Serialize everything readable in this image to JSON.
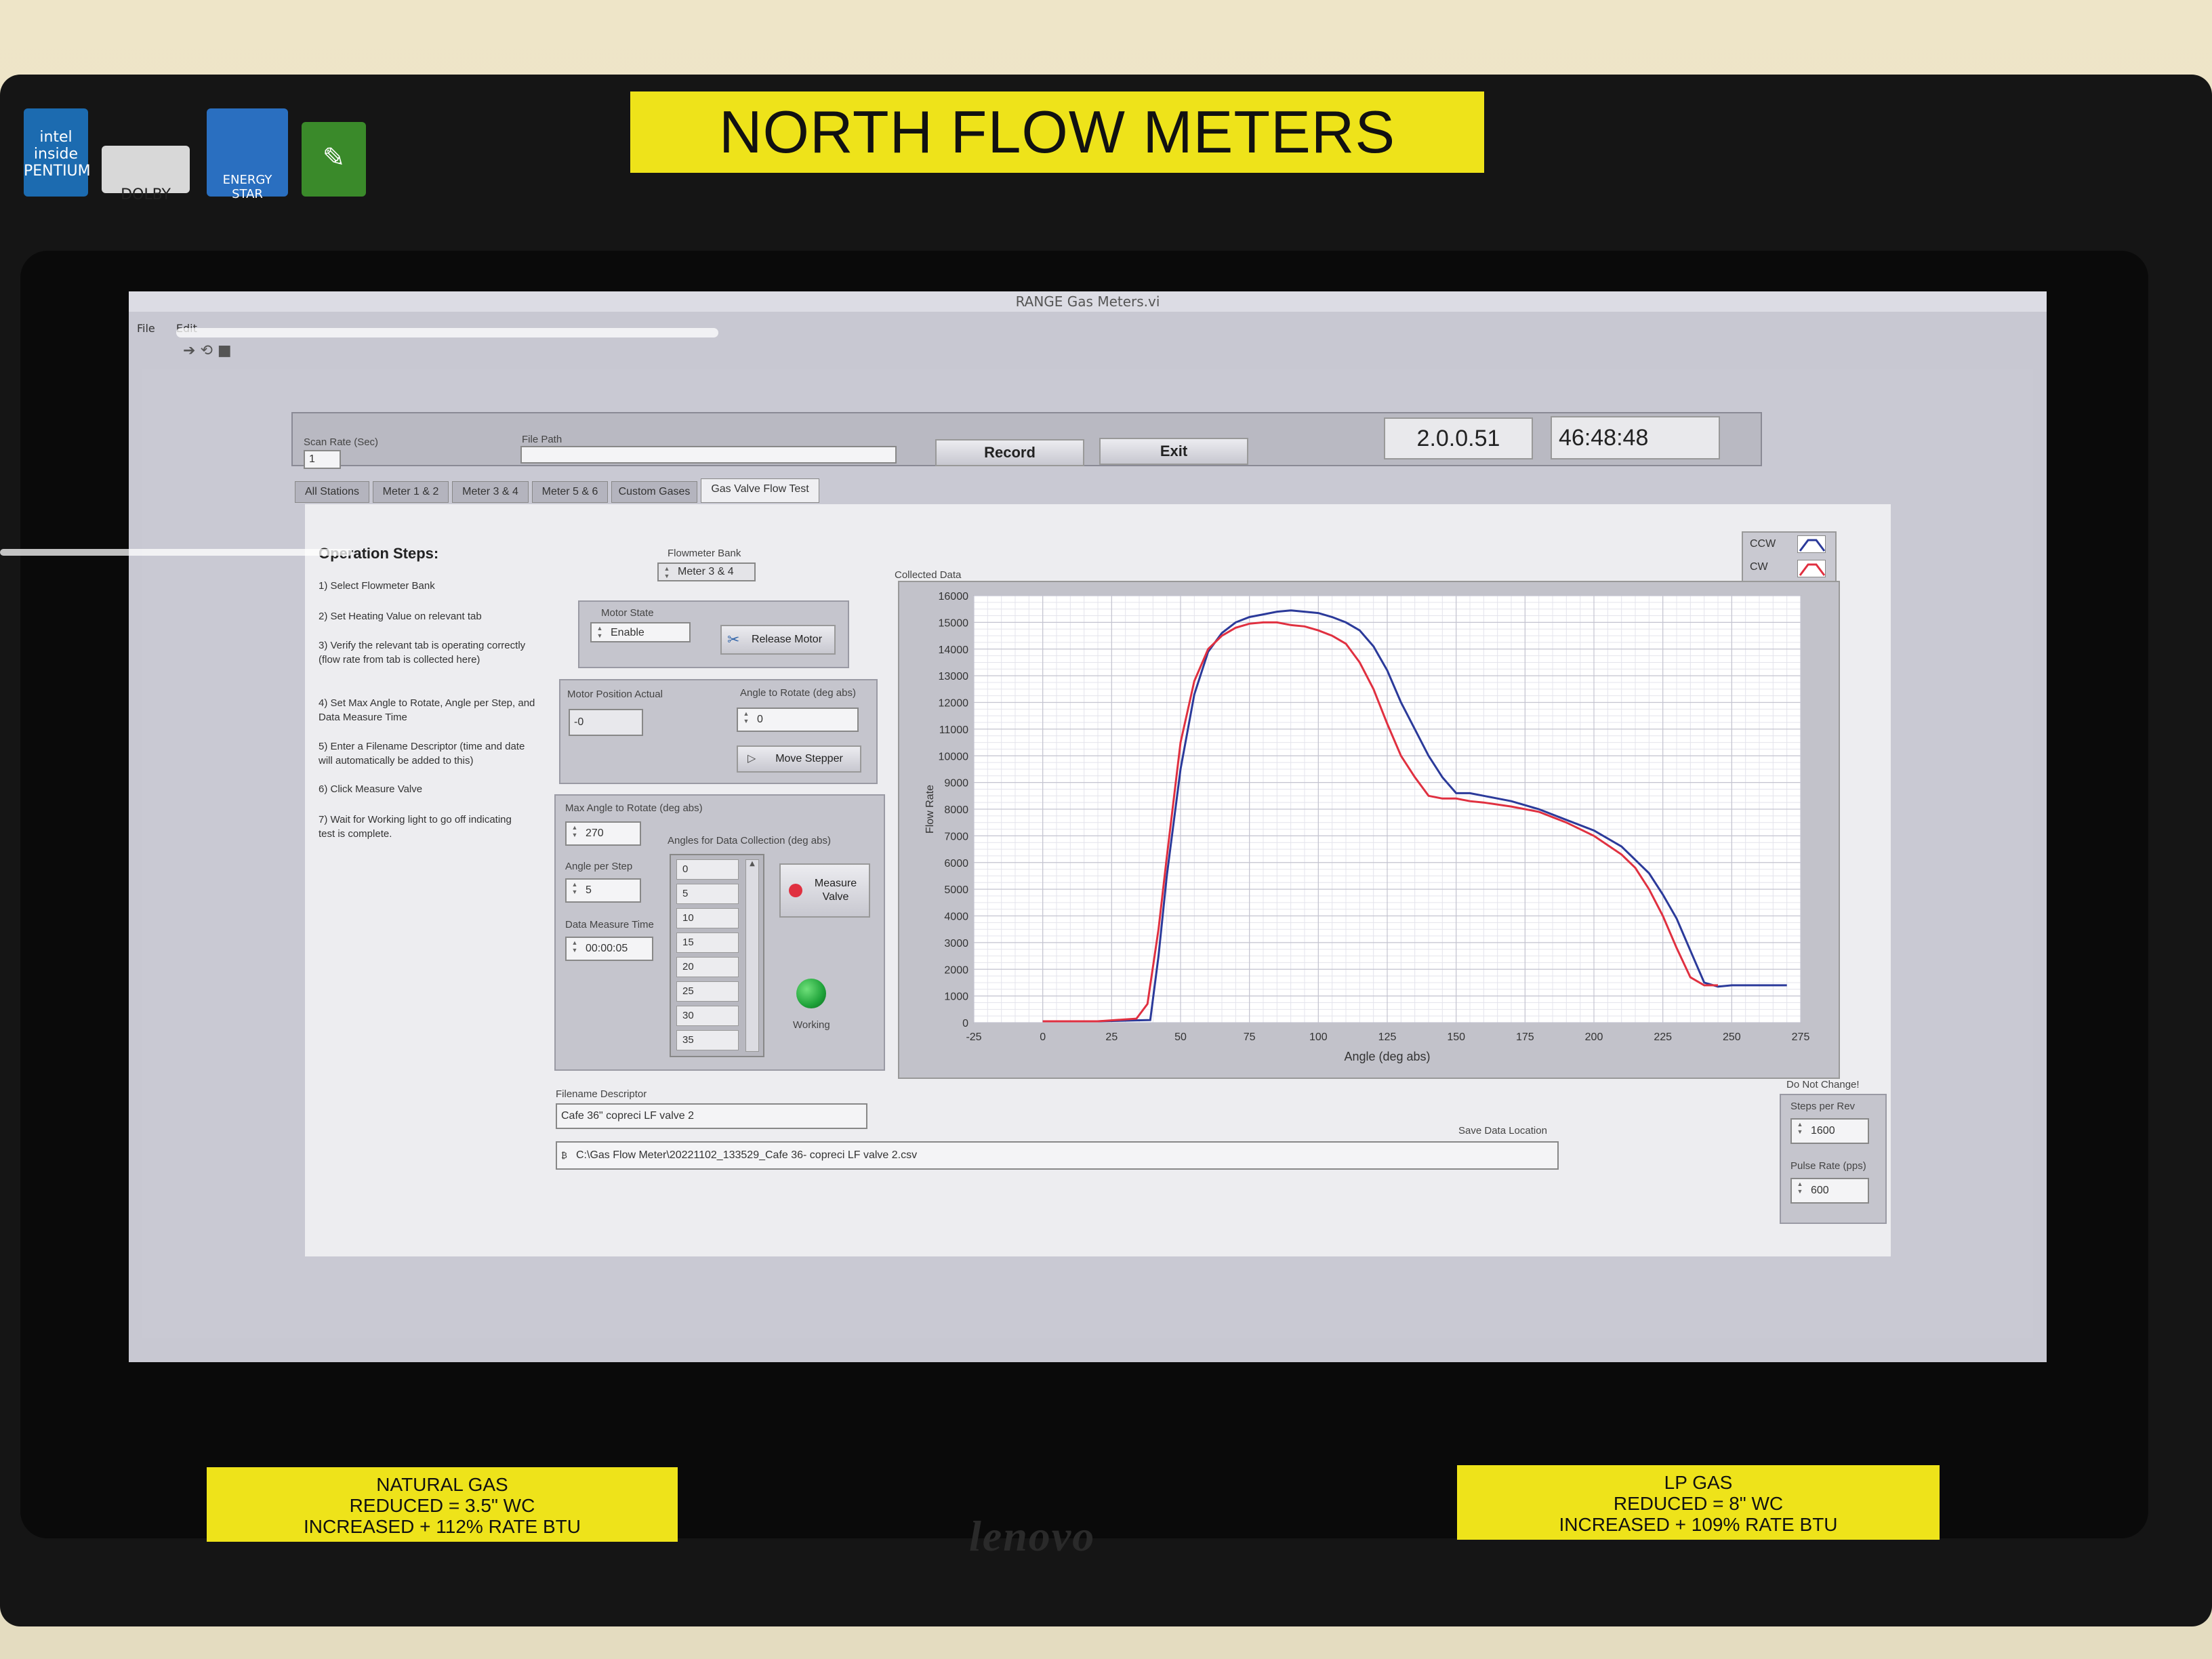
{
  "physical": {
    "top_label": "NORTH FLOW METERS",
    "stickers": {
      "intel": "intel inside PENTIUM",
      "dolby": "DOLBY",
      "energy": "ENERGY STAR"
    },
    "natural_gas_label": [
      "NATURAL GAS",
      "REDUCED = 3.5\" WC",
      "INCREASED + 112% RATE BTU"
    ],
    "lp_gas_label": [
      "LP GAS",
      "REDUCED = 8\" WC",
      "INCREASED + 109% RATE BTU"
    ],
    "brand": "lenovo"
  },
  "window": {
    "title": "RANGE Gas Meters.vi",
    "menu": [
      "File",
      "Edit"
    ]
  },
  "header": {
    "scan_rate_label": "Scan Rate (Sec)",
    "scan_rate_value": "1",
    "file_path_label": "File Path",
    "file_path_value": "",
    "record_label": "Record",
    "exit_label": "Exit",
    "version": "2.0.0.51",
    "timer": "46:48:48"
  },
  "tabs": [
    "All Stations",
    "Meter 1 & 2",
    "Meter 3 & 4",
    "Meter 5 & 6",
    "Custom Gases",
    "Gas Valve Flow Test"
  ],
  "operation": {
    "title": "Operation Steps:",
    "steps": [
      "1) Select Flowmeter Bank",
      "2) Set Heating Value on relevant tab",
      "3) Verify the relevant tab is operating correctly (flow rate from tab is collected here)",
      "4) Set Max Angle to Rotate, Angle per Step, and Data Measure Time",
      "5) Enter a Filename Descriptor (time and date will automatically be added to this)",
      "6) Click Measure Valve",
      "7) Wait for Working light to go off indicating test is complete."
    ]
  },
  "controls": {
    "flowmeter_bank_label": "Flowmeter Bank",
    "flowmeter_bank_value": "Meter 3 & 4",
    "motor_state_label": "Motor State",
    "motor_state_value": "Enable",
    "release_motor_label": "Release Motor",
    "motor_position_label": "Motor Position Actual",
    "motor_position_value": "-0",
    "angle_to_rotate_label": "Angle to Rotate  (deg abs)",
    "angle_to_rotate_value": "0",
    "move_stepper_label": "Move Stepper",
    "max_angle_label": "Max Angle to Rotate (deg abs)",
    "max_angle_value": "270",
    "angle_per_step_label": "Angle per Step",
    "angle_per_step_value": "5",
    "data_measure_time_label": "Data Measure Time",
    "data_measure_time_value": "00:00:05",
    "angles_list_label": "Angles for Data Collection (deg abs)",
    "angles_list": [
      "0",
      "5",
      "10",
      "15",
      "20",
      "25",
      "30",
      "35"
    ],
    "measure_valve_label": "Measure Valve",
    "working_label": "Working",
    "filename_descriptor_label": "Filename Descriptor",
    "filename_descriptor_value": "Cafe 36\" copreci LF valve 2",
    "save_location_label": "Save Data Location",
    "save_location_value": "C:\\Gas Flow Meter\\20221102_133529_Cafe 36- copreci LF valve 2.csv",
    "do_not_change_label": "Do Not Change!",
    "steps_per_rev_label": "Steps per Rev",
    "steps_per_rev_value": "1600",
    "pulse_rate_label": "Pulse Rate (pps)",
    "pulse_rate_value": "600"
  },
  "colors": {
    "ccw": "#2b3a9a",
    "cw": "#e03040",
    "working_led": "#1fa33a",
    "measure_led": "#e03040",
    "label_yellow": "#eee31a"
  },
  "chart_data": {
    "type": "line",
    "title": "Collected Data",
    "xlabel": "Angle (deg abs)",
    "ylabel": "Flow Rate",
    "xlim": [
      -25,
      275
    ],
    "ylim": [
      0,
      16000
    ],
    "x_ticks": [
      "-25",
      "0",
      "25",
      "50",
      "75",
      "100",
      "125",
      "150",
      "175",
      "200",
      "225",
      "250",
      "275"
    ],
    "y_ticks": [
      "0",
      "1000",
      "2000",
      "3000",
      "4000",
      "5000",
      "6000",
      "7000",
      "8000",
      "9000",
      "10000",
      "11000",
      "12000",
      "13000",
      "14000",
      "15000",
      "16000"
    ],
    "grid": true,
    "legend_position": "top-right",
    "series": [
      {
        "name": "CCW",
        "color": "#2b3a9a",
        "x": [
          0,
          20,
          39,
          42,
          45,
          50,
          55,
          60,
          65,
          70,
          75,
          80,
          85,
          90,
          95,
          100,
          105,
          110,
          115,
          120,
          125,
          130,
          135,
          140,
          145,
          150,
          155,
          160,
          170,
          180,
          190,
          200,
          210,
          215,
          220,
          225,
          230,
          235,
          240,
          245,
          250,
          260,
          270
        ],
        "y": [
          50,
          50,
          100,
          2500,
          5500,
          9500,
          12300,
          13900,
          14600,
          15000,
          15200,
          15300,
          15400,
          15450,
          15400,
          15350,
          15200,
          15000,
          14700,
          14100,
          13200,
          12000,
          11000,
          10000,
          9200,
          8600,
          8600,
          8500,
          8300,
          8000,
          7600,
          7200,
          6600,
          6100,
          5600,
          4800,
          3900,
          2700,
          1500,
          1350,
          1400,
          1400,
          1400
        ]
      },
      {
        "name": "CW",
        "color": "#e03040",
        "x": [
          0,
          20,
          34,
          38,
          42,
          45,
          50,
          55,
          60,
          65,
          70,
          75,
          80,
          85,
          90,
          95,
          100,
          105,
          110,
          115,
          120,
          125,
          130,
          135,
          140,
          145,
          150,
          155,
          160,
          170,
          180,
          190,
          200,
          210,
          215,
          220,
          225,
          230,
          235,
          240,
          245
        ],
        "y": [
          50,
          50,
          150,
          700,
          3500,
          6200,
          10500,
          12800,
          14000,
          14500,
          14800,
          14950,
          15000,
          15000,
          14900,
          14850,
          14700,
          14500,
          14200,
          13500,
          12500,
          11200,
          10000,
          9200,
          8500,
          8400,
          8400,
          8300,
          8250,
          8100,
          7900,
          7500,
          7000,
          6300,
          5800,
          5000,
          4000,
          2800,
          1700,
          1400,
          1400
        ]
      }
    ]
  }
}
